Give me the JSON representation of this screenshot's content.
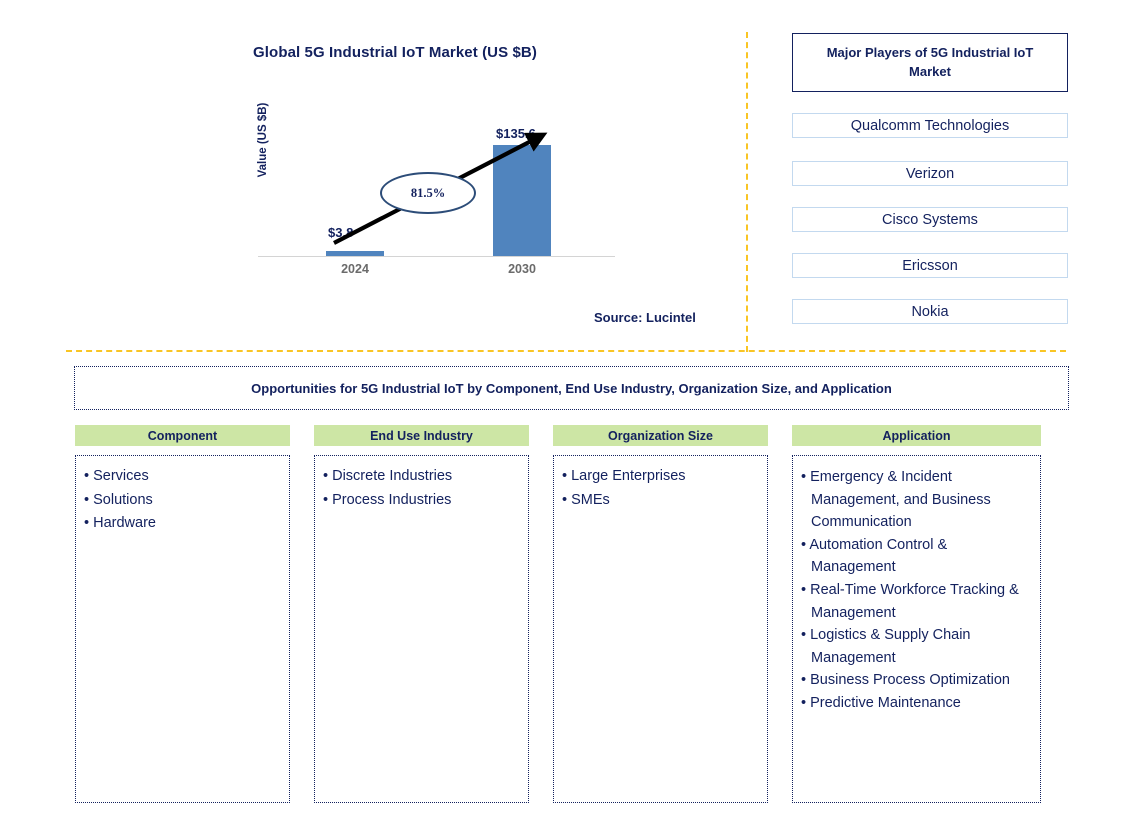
{
  "chart": {
    "title": "Global 5G Industrial IoT Market (US $B)",
    "y_axis_label": "Value (US $B)",
    "cagr_label": "81.5%",
    "value_2024": "$3.8",
    "value_2030": "$135.6",
    "tick_2024": "2024",
    "tick_2030": "2030",
    "bar_color": "#5084be",
    "source": "Source: Lucintel"
  },
  "chart_data": {
    "type": "bar",
    "title": "Global 5G Industrial IoT Market (US $B)",
    "xlabel": "",
    "ylabel": "Value (US $B)",
    "categories": [
      "2024",
      "2030"
    ],
    "values": [
      3.8,
      135.6
    ],
    "data_labels": [
      "$3.8",
      "$135.6"
    ],
    "ylim": [
      0,
      145
    ],
    "grid": false,
    "legend": "none",
    "annotations": [
      {
        "text": "81.5%",
        "type": "cagr-ellipse"
      },
      {
        "text": "Source: Lucintel",
        "type": "source"
      }
    ]
  },
  "players": {
    "header": "Major Players of 5G Industrial IoT Market",
    "items": [
      "Qualcomm Technologies",
      "Verizon",
      "Cisco Systems",
      "Ericsson",
      "Nokia"
    ]
  },
  "opportunities": {
    "banner": "Opportunities for 5G Industrial IoT by Component, End Use Industry, Organization Size, and Application",
    "columns": [
      {
        "header": "Component",
        "items": [
          "Services",
          "Solutions",
          "Hardware"
        ]
      },
      {
        "header": "End Use Industry",
        "items": [
          "Discrete Industries",
          "Process Industries"
        ]
      },
      {
        "header": "Organization Size",
        "items": [
          "Large Enterprises",
          "SMEs"
        ]
      },
      {
        "header": "Application",
        "items": [
          "Emergency & Incident Management, and Business Communication",
          "Automation Control & Management",
          "Real-Time Workforce Tracking & Management",
          "Logistics & Supply Chain Management",
          "Business Process Optimization",
          "Predictive Maintenance"
        ]
      }
    ]
  },
  "colors": {
    "navy": "#13215e",
    "bar_blue": "#5084be",
    "header_green": "#cde6a5",
    "divider_amber": "#f9c524",
    "player_border": "#c3d9ef"
  }
}
